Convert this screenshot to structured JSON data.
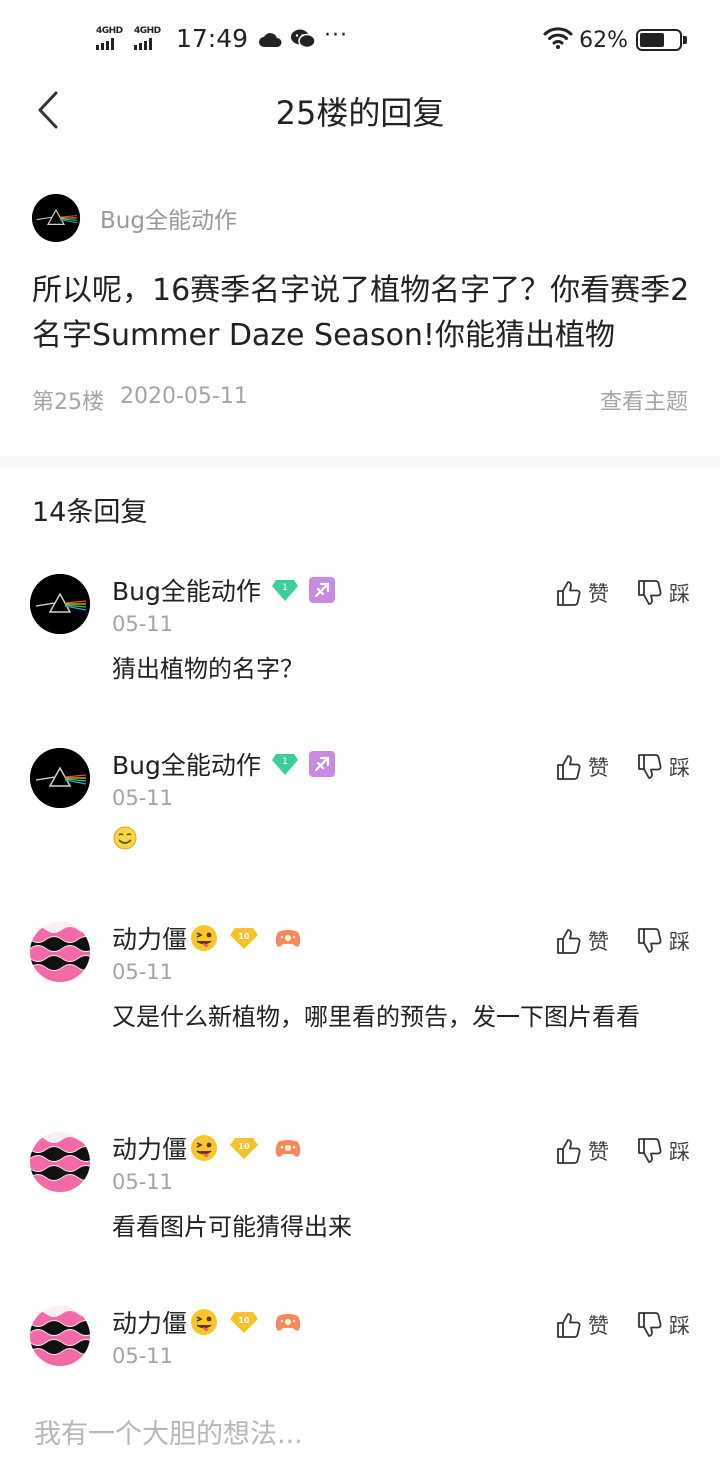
{
  "status_bar": {
    "network_1": "4GHD",
    "network_2": "4GHD",
    "time": "17:49",
    "more": "···",
    "battery": "62%",
    "battery_level": 0.62
  },
  "nav": {
    "title": "25楼的回复"
  },
  "post": {
    "author": "Bug全能动作",
    "text": "所以呢，16赛季名字说了植物名字了？你看赛季2名字Summer Daze Season!你能猜出植物",
    "floor": "第25楼",
    "date": "2020-05-11",
    "view_topic": "查看主题"
  },
  "reply_count": "14条回复",
  "actions": {
    "like": "赞",
    "dislike": "踩"
  },
  "replies": [
    {
      "author": "Bug全能动作",
      "date": "05-11",
      "text": "猜出植物的名字？"
    },
    {
      "author": "Bug全能动作",
      "date": "05-11",
      "text": ""
    },
    {
      "author": "动力僵",
      "date": "05-11",
      "text": "又是什么新植物，哪里看的预告，发一下图片看看"
    },
    {
      "author": "动力僵",
      "date": "05-11",
      "text": "看看图片可能猜得出来"
    },
    {
      "author": "动力僵",
      "date": "05-11",
      "text": ""
    }
  ],
  "comment_input": {
    "placeholder": "我有一个大胆的想法..."
  },
  "colors": {
    "text": "#222222",
    "meta": "#a5a5a5",
    "divider": "#faf6fa",
    "gem": "#3ccf9d",
    "zodiac": "#c98be0",
    "level_badge": "#f6c22b"
  }
}
